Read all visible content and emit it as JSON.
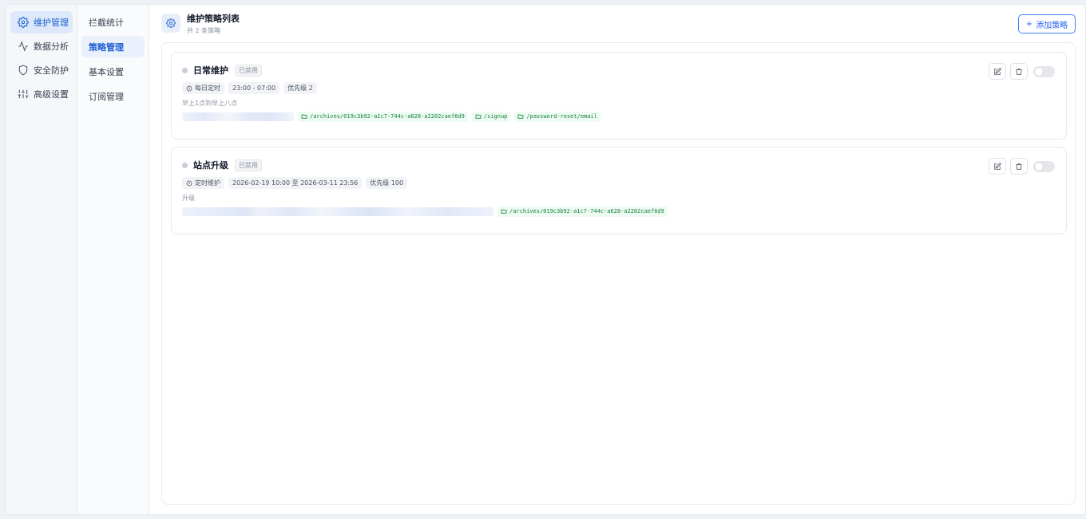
{
  "sidebar": {
    "items": [
      {
        "label": "维护管理",
        "icon": "gear-icon",
        "active": true
      },
      {
        "label": "数据分析",
        "icon": "activity-icon",
        "active": false
      },
      {
        "label": "安全防护",
        "icon": "shield-icon",
        "active": false
      },
      {
        "label": "高级设置",
        "icon": "sliders-icon",
        "active": false
      }
    ]
  },
  "subnav": {
    "items": [
      {
        "label": "拦截统计",
        "active": false
      },
      {
        "label": "策略管理",
        "active": true
      },
      {
        "label": "基本设置",
        "active": false
      },
      {
        "label": "订阅管理",
        "active": false
      }
    ]
  },
  "header": {
    "title": "维护策略列表",
    "subtitle": "共 2 条策略",
    "add_label": "添加策略"
  },
  "policies": [
    {
      "name": "日常维护",
      "status": "已禁用",
      "schedule_type": "每日定时",
      "time_range": "23:00 - 07:00",
      "priority": "优先级 2",
      "description": "早上1点到早上八点",
      "paths": [
        "/archives/019c3b92-a1c7-744c-a628-a2202caef6d9",
        "/signup",
        "/password-reset/email"
      ]
    },
    {
      "name": "站点升级",
      "status": "已禁用",
      "schedule_type": "定时维护",
      "time_range": "2026-02-19 10:00 至 2026-03-11 23:56",
      "priority": "优先级 100",
      "description": "升级",
      "paths": [
        "/archives/019c3b92-a1c7-744c-a628-a2202caef6d9"
      ]
    }
  ],
  "colors": {
    "accent": "#2563eb",
    "path_text": "#15803d",
    "path_bg": "#eefbf2"
  }
}
